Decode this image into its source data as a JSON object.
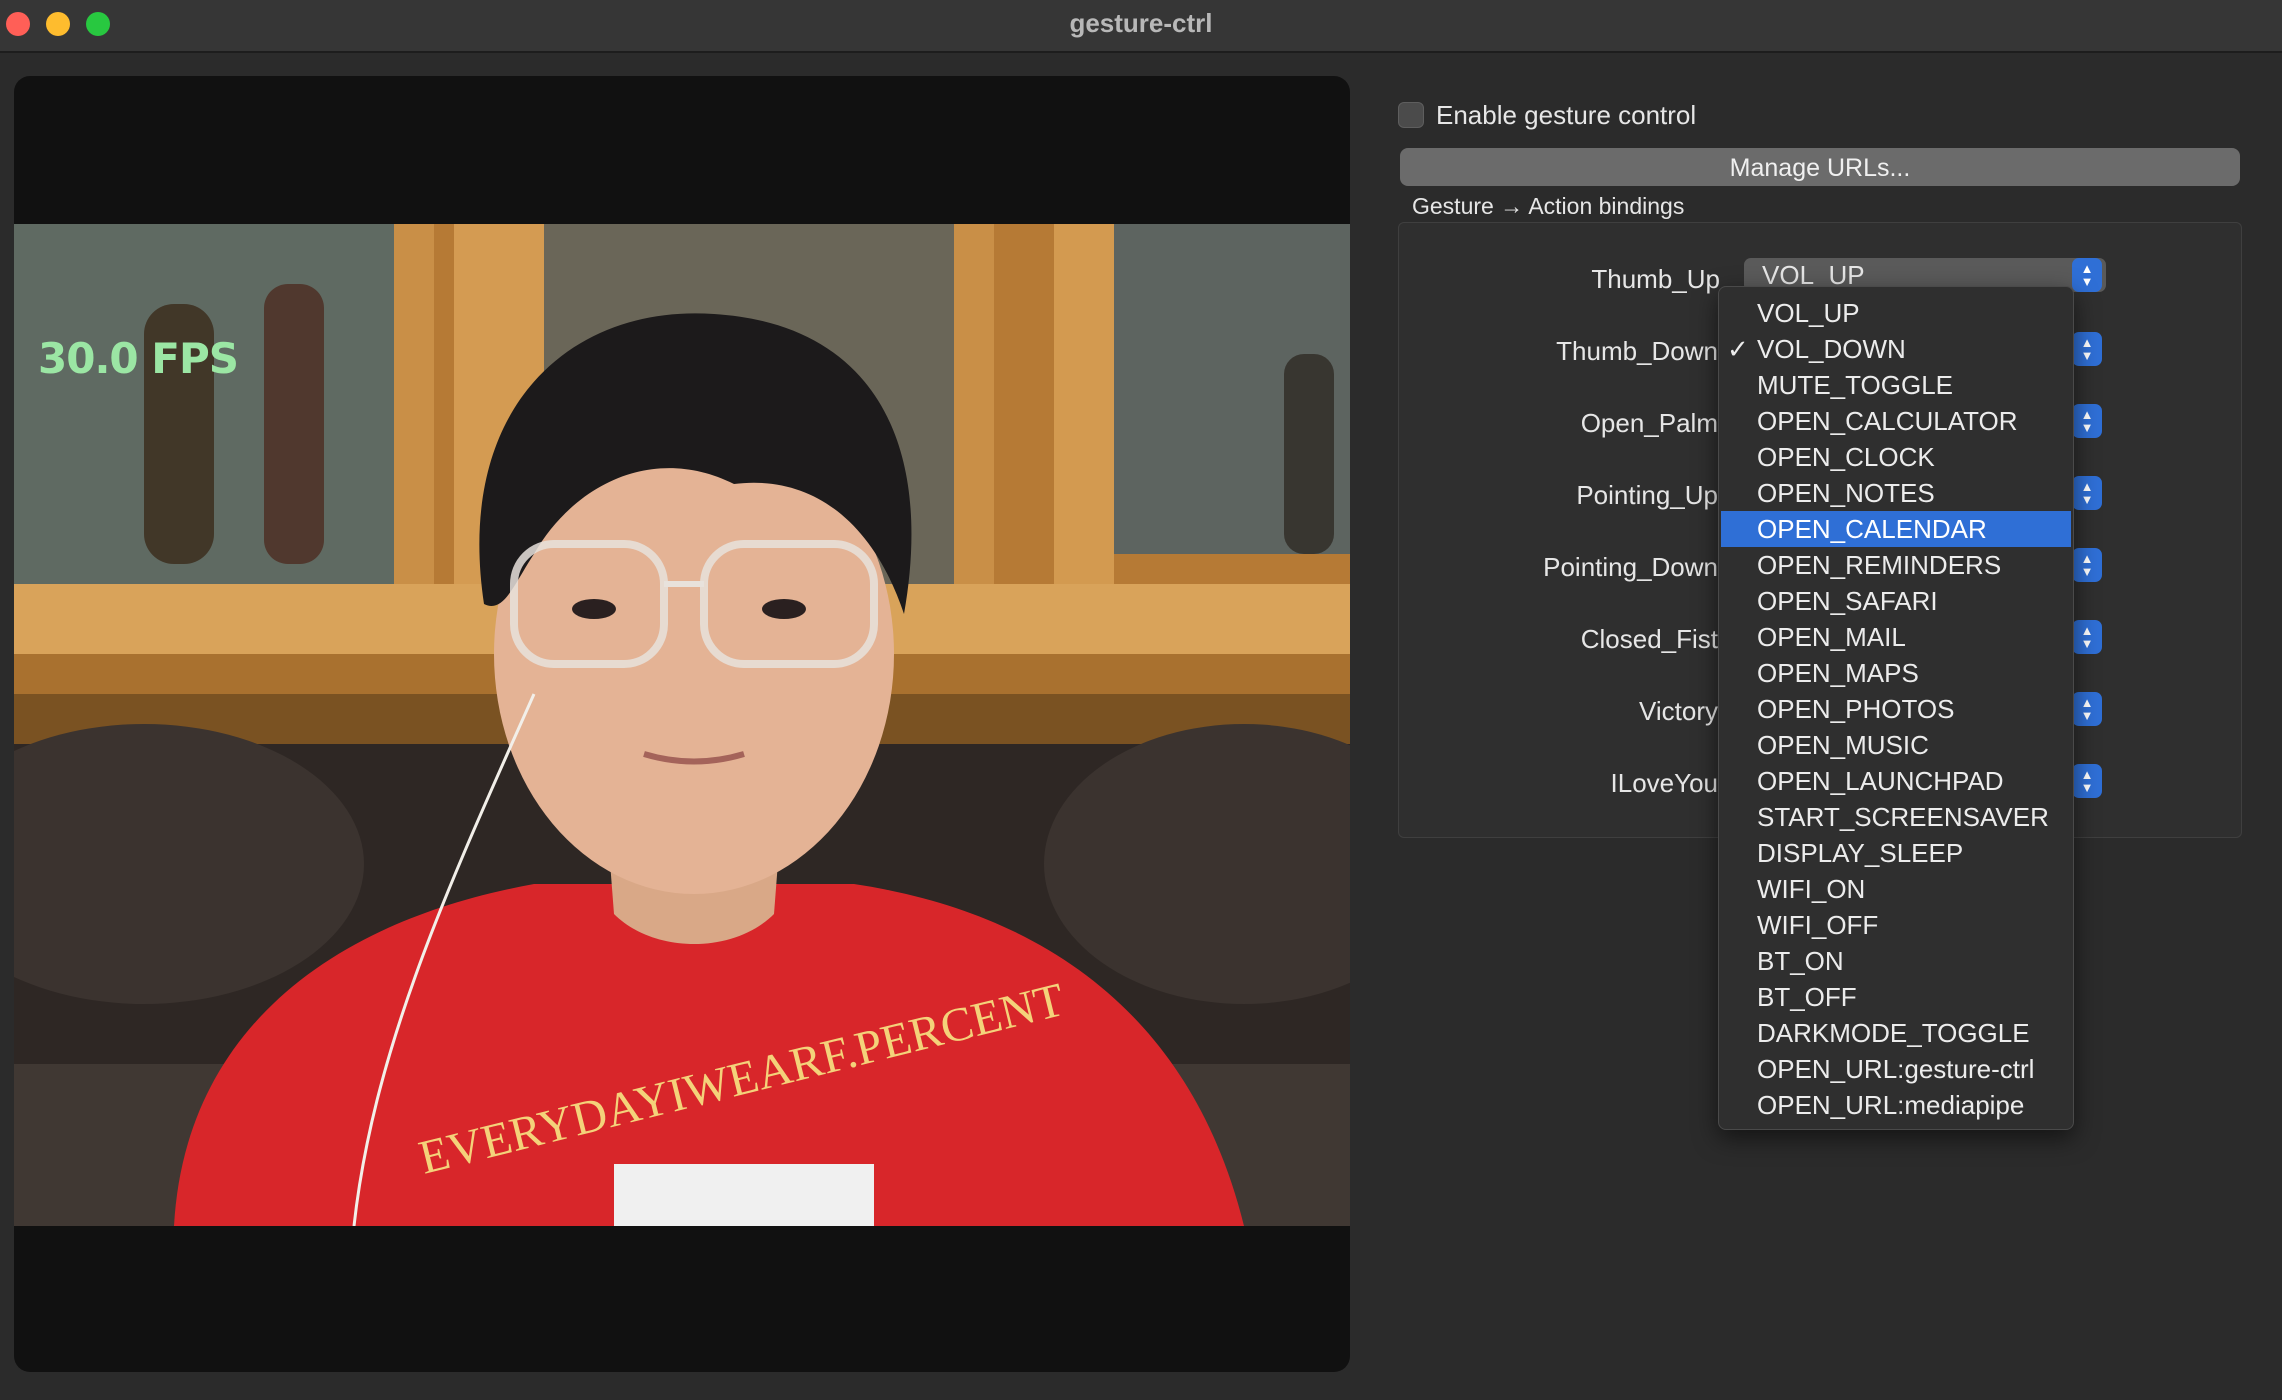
{
  "window": {
    "title": "gesture-ctrl"
  },
  "camera": {
    "fps_text": "30.0 FPS",
    "shirt_text": "EVERYDAYIWEARF.PERCENT"
  },
  "controls": {
    "enable_label": "Enable gesture control",
    "enable_checked": false,
    "manage_urls_label": "Manage URLs...",
    "bindings_title": "Gesture → Action bindings"
  },
  "bindings": [
    {
      "gesture": "Thumb_Up",
      "action": "VOL_UP"
    },
    {
      "gesture": "Thumb_Down",
      "action": "VOL_DOWN"
    },
    {
      "gesture": "Open_Palm",
      "action": ""
    },
    {
      "gesture": "Pointing_Up",
      "action": ""
    },
    {
      "gesture": "Pointing_Down",
      "action": ""
    },
    {
      "gesture": "Closed_Fist",
      "action": ""
    },
    {
      "gesture": "Victory",
      "action": ""
    },
    {
      "gesture": "ILoveYou",
      "action": ""
    }
  ],
  "dropdown": {
    "checked_item": "VOL_DOWN",
    "highlighted_item": "OPEN_CALENDAR",
    "items": [
      "VOL_UP",
      "VOL_DOWN",
      "MUTE_TOGGLE",
      "OPEN_CALCULATOR",
      "OPEN_CLOCK",
      "OPEN_NOTES",
      "OPEN_CALENDAR",
      "OPEN_REMINDERS",
      "OPEN_SAFARI",
      "OPEN_MAIL",
      "OPEN_MAPS",
      "OPEN_PHOTOS",
      "OPEN_MUSIC",
      "OPEN_LAUNCHPAD",
      "START_SCREENSAVER",
      "DISPLAY_SLEEP",
      "WIFI_ON",
      "WIFI_OFF",
      "BT_ON",
      "BT_OFF",
      "DARKMODE_TOGGLE",
      "OPEN_URL:gesture-ctrl",
      "OPEN_URL:mediapipe"
    ]
  },
  "colors": {
    "accent": "#2f6fd6",
    "fps_text": "#9be6a4",
    "shirt": "#d8262a"
  }
}
